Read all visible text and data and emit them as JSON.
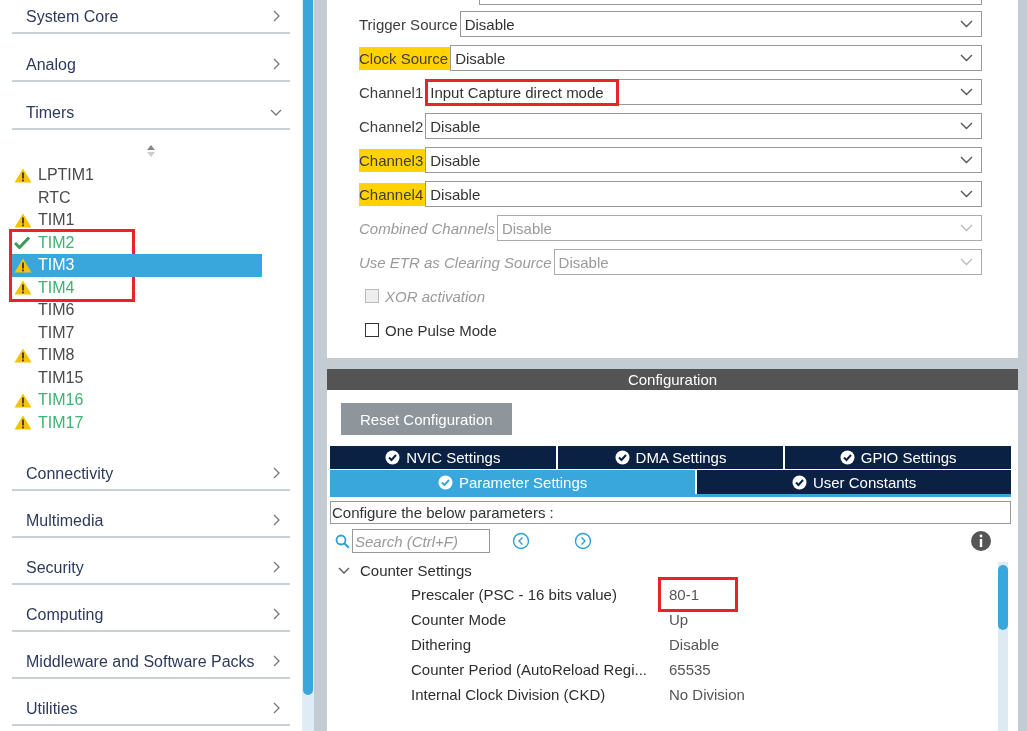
{
  "sidebar": {
    "categories_top": [
      {
        "label": "System Core",
        "expanded": false
      },
      {
        "label": "Analog",
        "expanded": false
      },
      {
        "label": "Timers",
        "expanded": true
      }
    ],
    "timers": [
      {
        "label": "LPTIM1",
        "kind": "warning",
        "color": "#4a4a4a",
        "selected": false,
        "highlighted": false
      },
      {
        "label": "RTC",
        "kind": "plain",
        "color": "#4a4a4a",
        "selected": false,
        "highlighted": false
      },
      {
        "label": "TIM1",
        "kind": "warning",
        "color": "#4a4a4a",
        "selected": false,
        "highlighted": false
      },
      {
        "label": "TIM2",
        "kind": "ok",
        "color": "#3cb371",
        "selected": false,
        "highlighted": true
      },
      {
        "label": "TIM3",
        "kind": "warning",
        "color": "#ffffff",
        "selected": true,
        "highlighted": true
      },
      {
        "label": "TIM4",
        "kind": "warning",
        "color": "#3cb371",
        "selected": false,
        "highlighted": true
      },
      {
        "label": "TIM6",
        "kind": "plain",
        "color": "#4a4a4a",
        "selected": false,
        "highlighted": false
      },
      {
        "label": "TIM7",
        "kind": "plain",
        "color": "#4a4a4a",
        "selected": false,
        "highlighted": false
      },
      {
        "label": "TIM8",
        "kind": "warning",
        "color": "#4a4a4a",
        "selected": false,
        "highlighted": false
      },
      {
        "label": "TIM15",
        "kind": "plain",
        "color": "#4a4a4a",
        "selected": false,
        "highlighted": false
      },
      {
        "label": "TIM16",
        "kind": "warning",
        "color": "#3cb371",
        "selected": false,
        "highlighted": false
      },
      {
        "label": "TIM17",
        "kind": "warning",
        "color": "#3cb371",
        "selected": false,
        "highlighted": false
      }
    ],
    "categories_bottom": [
      {
        "label": "Connectivity",
        "expanded": false
      },
      {
        "label": "Multimedia",
        "expanded": false
      },
      {
        "label": "Security",
        "expanded": false
      },
      {
        "label": "Computing",
        "expanded": false
      },
      {
        "label": "Middleware and Software Packs",
        "expanded": false
      },
      {
        "label": "Utilities",
        "expanded": false
      }
    ]
  },
  "mode": {
    "rows": [
      {
        "kind": "select",
        "label": "Trigger Source",
        "value": "Disable",
        "warning": false,
        "disabled": false,
        "highlighted": false
      },
      {
        "kind": "select",
        "label": "Clock Source",
        "value": "Disable",
        "warning": true,
        "disabled": false,
        "highlighted": false
      },
      {
        "kind": "select",
        "label": "Channel1",
        "value": "Input Capture direct mode",
        "warning": false,
        "disabled": false,
        "highlighted": true
      },
      {
        "kind": "select",
        "label": "Channel2",
        "value": "Disable",
        "warning": false,
        "disabled": false,
        "highlighted": false
      },
      {
        "kind": "select",
        "label": "Channel3",
        "value": "Disable",
        "warning": true,
        "disabled": false,
        "highlighted": false
      },
      {
        "kind": "select",
        "label": "Channel4",
        "value": "Disable",
        "warning": true,
        "disabled": false,
        "highlighted": false
      },
      {
        "kind": "select",
        "label": "Combined Channels",
        "value": "Disable",
        "warning": false,
        "disabled": true,
        "highlighted": false
      },
      {
        "kind": "select",
        "label": "Use ETR as Clearing Source",
        "value": "Disable",
        "warning": false,
        "disabled": true,
        "highlighted": false
      },
      {
        "kind": "checkbox",
        "label": "XOR activation",
        "checked": false,
        "disabled": true
      },
      {
        "kind": "checkbox",
        "label": "One Pulse Mode",
        "checked": false,
        "disabled": false
      }
    ]
  },
  "configuration": {
    "title": "Configuration",
    "reset_button": "Reset Configuration",
    "tabs": [
      [
        {
          "label": "NVIC Settings",
          "selected": false
        },
        {
          "label": "DMA Settings",
          "selected": false
        },
        {
          "label": "GPIO Settings",
          "selected": false
        }
      ],
      [
        {
          "label": "Parameter Settings",
          "selected": true
        },
        {
          "label": "User Constants",
          "selected": false
        }
      ]
    ],
    "description": "Configure the below parameters :",
    "search": {
      "placeholder": "Search (Ctrl+F)"
    },
    "groups": [
      {
        "label": "Counter Settings",
        "expanded": true,
        "children": [
          {
            "name": "Prescaler (PSC - 16 bits value)",
            "value": "80-1",
            "highlighted": true
          },
          {
            "name": "Counter Mode",
            "value": "Up",
            "highlighted": false
          },
          {
            "name": "Dithering",
            "value": "Disable",
            "highlighted": false
          },
          {
            "name": "Counter Period (AutoReload Regi...",
            "value": "65535",
            "highlighted": false
          },
          {
            "name": "Internal Clock Division (CKD)",
            "value": "No Division",
            "highlighted": false
          }
        ]
      }
    ]
  }
}
